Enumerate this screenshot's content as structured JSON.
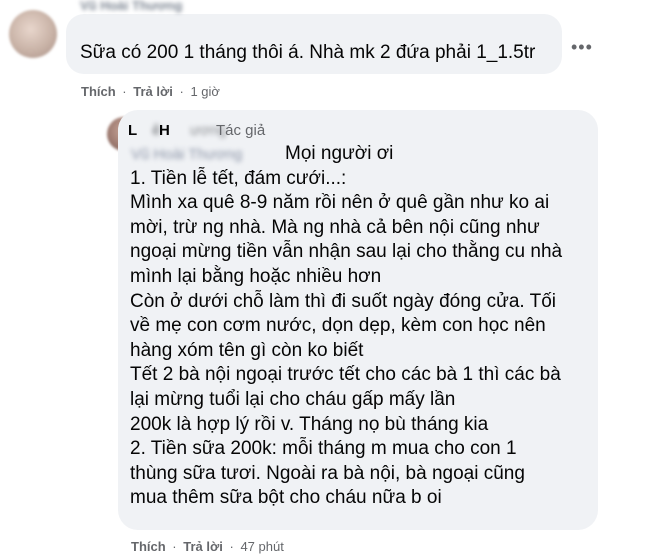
{
  "top_comment": {
    "author_blurred": "Vũ Hoài Thương",
    "text": "Sữa có 200 1 tháng thôi á. Nhà mk 2 đứa phải 1_1.5tr",
    "actions": {
      "like": "Thích",
      "reply": "Trả lời",
      "time": "1 giờ"
    },
    "more_icon": "more-horizontal-icon"
  },
  "reply": {
    "author_initial_1": "L",
    "author_blurred_1": "ê",
    "author_initial_2": "H",
    "author_blurred_2": "ương",
    "badge": "Tác giả",
    "tagged_blurred": "Vũ Hoài Thương",
    "lines": [
      "Mọi người ơi",
      "1. Tiền lễ tết, đám cưới...:",
      "Mình xa quê 8-9 năm rồi nên ở quê gần như ko ai",
      "mời, trừ ng nhà. Mà ng nhà cả bên nội cũng như",
      "ngoại mừng tiền vẫn nhận sau lại cho thằng cu nhà",
      "mình lại bằng hoặc nhiều hơn",
      "Còn ở dưới chỗ làm thì đi suốt ngày đóng cửa. Tối",
      "về mẹ con cơm nước, dọn dẹp, kèm con học nên",
      "hàng xóm tên gì còn ko biết",
      "Tết 2 bà nội ngoại trước tết cho các bà 1 thì các bà",
      "lại mừng tuổi lại cho cháu gấp mấy lần",
      "200k là hợp lý rồi v. Tháng nọ bù tháng kia",
      "2. Tiền sữa 200k: mỗi tháng m mua cho con 1",
      "thùng sữa tươi. Ngoài ra bà nội, bà ngoại cũng",
      "mua thêm sữa bột cho cháu nữa b oi"
    ],
    "actions": {
      "like": "Thích",
      "reply": "Trả lời",
      "time": "47 phút"
    }
  },
  "separator": "·"
}
